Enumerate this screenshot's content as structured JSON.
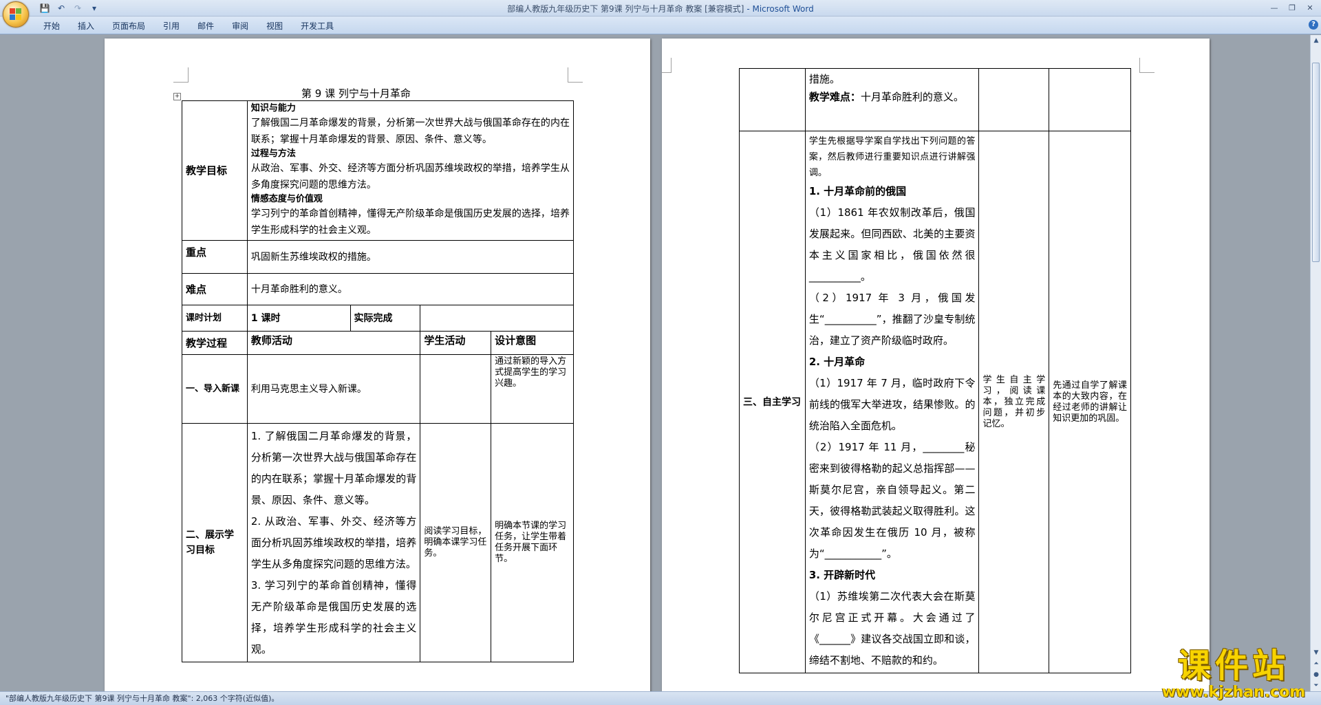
{
  "window": {
    "title": "部编人教版九年级历史下 第9课 列宁与十月革命 教案 [兼容模式]",
    "app_name": "- Microsoft Word"
  },
  "qat": {
    "save_icon": "💾",
    "undo_icon": "↶",
    "redo_icon": "↷",
    "menu_icon": "▾"
  },
  "ribbon": {
    "tabs": [
      "开始",
      "插入",
      "页面布局",
      "引用",
      "邮件",
      "审阅",
      "视图",
      "开发工具"
    ]
  },
  "window_controls": {
    "minimize": "—",
    "maximize": "❐",
    "close": "✕"
  },
  "help_label": "?",
  "doc": {
    "title": "第 9 课    列宁与十月革命",
    "goals_label": "教学目标",
    "goals": {
      "h1": "知识与能力",
      "p1": "了解俄国二月革命爆发的背景，分析第一次世界大战与俄国革命存在的内在联系；掌握十月革命爆发的背景、原因、条件、意义等。",
      "h2": "过程与方法",
      "p2": "从政治、军事、外交、经济等方面分析巩固苏维埃政权的举措，培养学生从多角度探究问题的思维方法。",
      "h3": "情感态度与价值观",
      "p3": "学习列宁的革命首创精神，懂得无产阶级革命是俄国历史发展的选择，培养学生形成科学的社会主义观。"
    },
    "key_label": "重点",
    "key_text": "巩固新生苏维埃政权的措施。",
    "diff_label": "难点",
    "diff_text": "十月革命胜利的意义。",
    "plan_label": "课时计划",
    "plan_value": "1 课时",
    "actual_label": "实际完成",
    "process_headers": [
      "教学过程",
      "教师活动",
      "学生活动",
      "设计意图"
    ],
    "rows": [
      {
        "stage": "一、导入新课",
        "teacher": "利用马克思主义导入新课。",
        "student": "",
        "design": "通过新颖的导入方式提高学生的学习兴趣。"
      },
      {
        "stage": "二、展示学习目标",
        "teacher_items": [
          "1. 了解俄国二月革命爆发的背景，分析第一次世界大战与俄国革命存在的内在联系；掌握十月革命爆发的背景、原因、条件、意义等。",
          "2. 从政治、军事、外交、经济等方面分析巩固苏维埃政权的举措，培养学生从多角度探究问题的思维方法。",
          "3. 学习列宁的革命首创精神，懂得无产阶级革命是俄国历史发展的选择，培养学生形成科学的社会主义观。"
        ],
        "student": "阅读学习目标，明确本课学习任务。",
        "design": "明确本节课的学习任务，让学生带着任务开展下面环节。"
      }
    ],
    "right": {
      "cont_line1": "措施。",
      "cont_line2_label": "教学难点：",
      "cont_line2_text": "十月革命胜利的意义。",
      "stage": "三、自主学习",
      "intro": "学生先根据导学案自学找出下列问题的答案，然后教师进行重要知识点进行讲解强调。",
      "s1_head": "1. 十月革命前的俄国",
      "s1_p1": "（1）1861 年农奴制改革后，俄国发展起来。但同西欧、北美的主要资本主义国家相比，俄国依然很__________。",
      "s1_p2": "（2）1917 年 3 月，俄国发生“__________”，推翻了沙皇专制统治，建立了资产阶级临时政府。",
      "s2_head": "2. 十月革命",
      "s2_p1": "（1）1917 年 7 月，临时政府下令前线的俄军大举进攻，结果惨败。的统治陷入全面危机。",
      "s2_p2": "（2）1917 年 11 月，________秘密来到彼得格勒的起义总指挥部——斯莫尔尼宫，亲自领导起义。第二天，彼得格勒武装起义取得胜利。这次革命因发生在俄历 10 月，被称为“___________”。",
      "s3_head": "3. 开辟新时代",
      "s3_p1": "（1）苏维埃第二次代表大会在斯莫尔尼宫正式开幕。大会通过了《______》建议各交战国立即和谈，缔结不割地、不赔款的和约。",
      "student": "学生自主学习，阅读课本，独立完成问题，并初步记忆。",
      "design": "先通过自学了解课本的大致内容，在经过老师的讲解让知识更加的巩固。"
    }
  },
  "status": {
    "text": "\"部编人教版九年级历史下 第9课 列宁与十月革命 教案\": 2,063 个字符(近似值)。"
  },
  "watermark": {
    "big": "课件站",
    "url": "www.kjzhan.com"
  },
  "colors": {
    "logo_red": "#e3432b",
    "logo_green": "#6cb33f",
    "logo_blue": "#2b79d0",
    "logo_yellow": "#f7c51c"
  }
}
